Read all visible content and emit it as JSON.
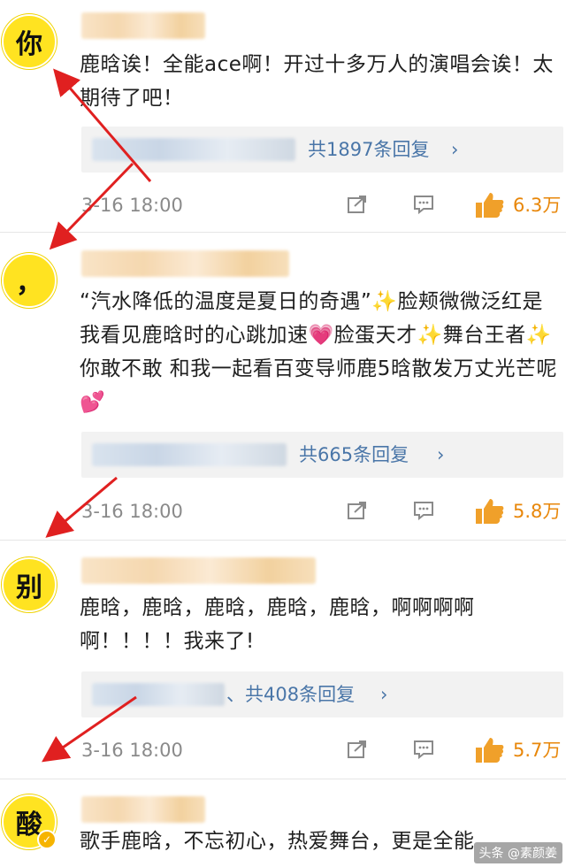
{
  "posts": [
    {
      "avatar_char": "你",
      "content": "鹿晗诶！全能ace啊！开过十多万人的演唱会诶！太期待了吧！",
      "reply_count": "共1897条回复",
      "time": "3-16 18:00",
      "likes": "6.3万"
    },
    {
      "avatar_char": "，",
      "content": "“汽水降低的温度是夏日的奇遇”✨脸颊微微泛红是我看见鹿晗时的心跳加速💗脸蛋天才✨舞台王者✨你敢不敢 和我一起看百变导师鹿5晗散发万丈光芒呢💕",
      "reply_count": "共665条回复",
      "time": "3-16 18:00",
      "likes": "5.8万"
    },
    {
      "avatar_char": "别",
      "content": "鹿晗，鹿晗，鹿晗，鹿晗，鹿晗，啊啊啊啊啊！！！！我来了!",
      "reply_count": "、共408条回复",
      "time": "3-16 18:00",
      "likes": "5.7万"
    },
    {
      "avatar_char": "酸",
      "content": "歌手鹿晗，不忘初心，热爱舞台，更是全能"
    }
  ],
  "icons": {
    "reply_chevron": "chevron-right-icon",
    "share": "share-icon",
    "comment": "comment-icon",
    "like": "thumbs-up-icon",
    "verified": "verified-badge-icon"
  },
  "colors": {
    "avatar_bg": "#ffe321",
    "link": "#4a76a8",
    "likes": "#e8870a",
    "arrow": "#e02020"
  },
  "watermark": "头条 @素颜姜"
}
